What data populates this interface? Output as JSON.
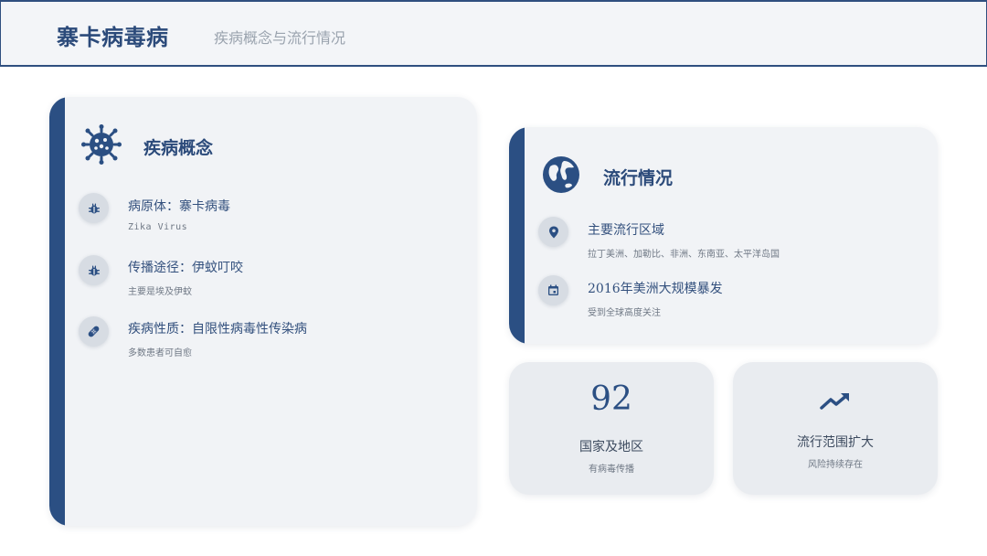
{
  "header": {
    "title": "寨卡病毒病",
    "subtitle": "疾病概念与流行情况"
  },
  "concept": {
    "title": "疾病概念",
    "icon": "virus-icon",
    "items": [
      {
        "icon": "bug-icon",
        "title": "病原体：寨卡病毒",
        "desc": "Zika Virus"
      },
      {
        "icon": "bug-icon",
        "title": "传播途径：伊蚊叮咬",
        "desc": "主要是埃及伊蚊"
      },
      {
        "icon": "bandage-icon",
        "title": "疾病性质：自限性病毒性传染病",
        "desc": "多数患者可自愈"
      }
    ]
  },
  "epidemic": {
    "title": "流行情况",
    "icon": "globe-icon",
    "items": [
      {
        "icon": "location-pin-icon",
        "title": "主要流行区域",
        "desc": "拉丁美洲、加勒比、非洲、东南亚、太平洋岛国"
      },
      {
        "icon": "calendar-icon",
        "title": "2016年美洲大规模暴发",
        "desc": "受到全球高度关注"
      }
    ]
  },
  "stats": {
    "countries": {
      "value": "92",
      "label": "国家及地区",
      "desc": "有病毒传播"
    },
    "spread": {
      "icon": "trending-up-icon",
      "label": "流行范围扩大",
      "desc": "风险持续存在"
    }
  },
  "colors": {
    "accent": "#2b4f83",
    "card_bg": "#f1f3f6",
    "stat_bg": "#e9ecf0",
    "icon_circle": "#d7dce3"
  }
}
